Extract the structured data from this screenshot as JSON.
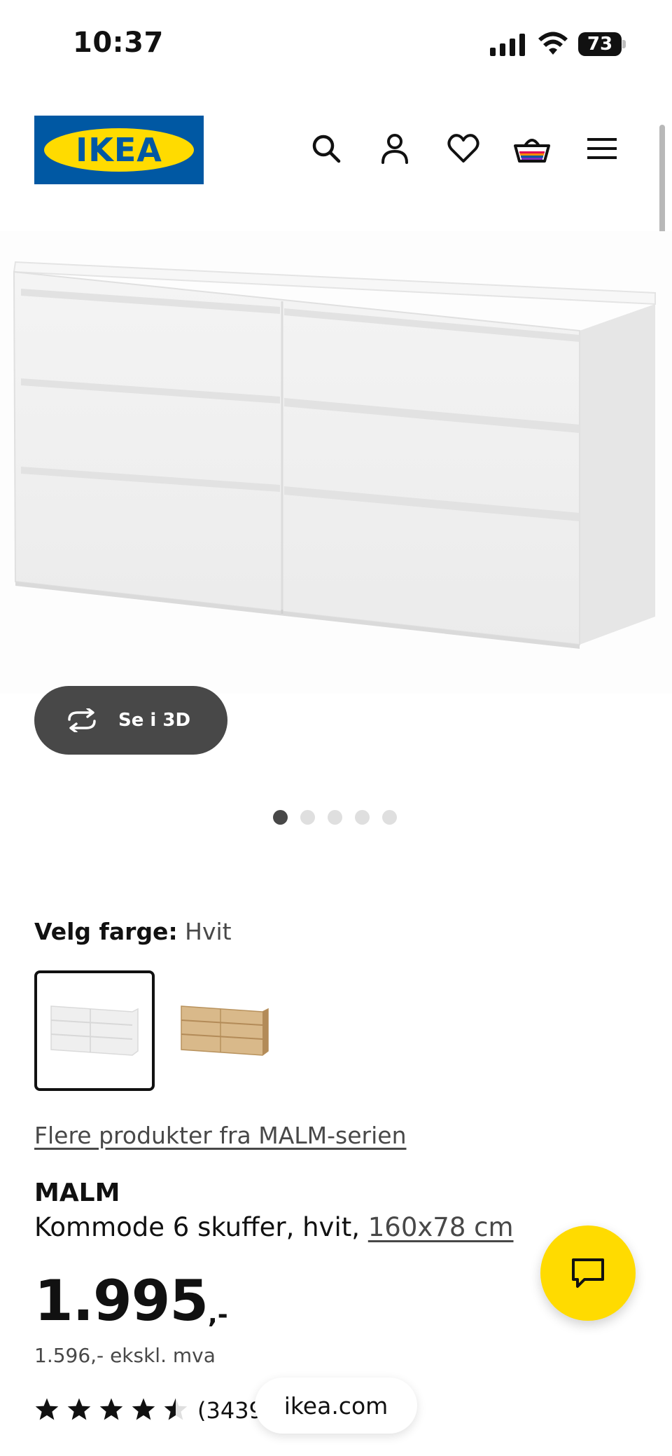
{
  "status_bar": {
    "time": "10:37",
    "battery": "73"
  },
  "header": {
    "logo_text": "IKEA",
    "icons": [
      "search-icon",
      "account-icon",
      "heart-icon",
      "basket-icon",
      "menu-icon"
    ]
  },
  "gallery": {
    "see_3d_label": "Se i 3D",
    "dots_total": 5,
    "dots_active": 1
  },
  "color": {
    "label": "Velg farge:",
    "value": "Hvit",
    "swatches": [
      "white",
      "oak"
    ]
  },
  "series_link": "Flere produkter fra MALM-serien",
  "product": {
    "name": "MALM",
    "description": "Kommode 6 skuffer, hvit,",
    "dimensions": "160x78 cm",
    "price_main": "1.995",
    "price_suffix": ",-",
    "price_ex_vat": "1.596,- ekskl. mva",
    "rating": 4.5,
    "review_count": "(3439"
  },
  "browser": {
    "url": "ikea.com"
  },
  "colors": {
    "ikea_blue": "#0058a3",
    "ikea_yellow": "#ffdb00",
    "dark_button": "#484848"
  }
}
